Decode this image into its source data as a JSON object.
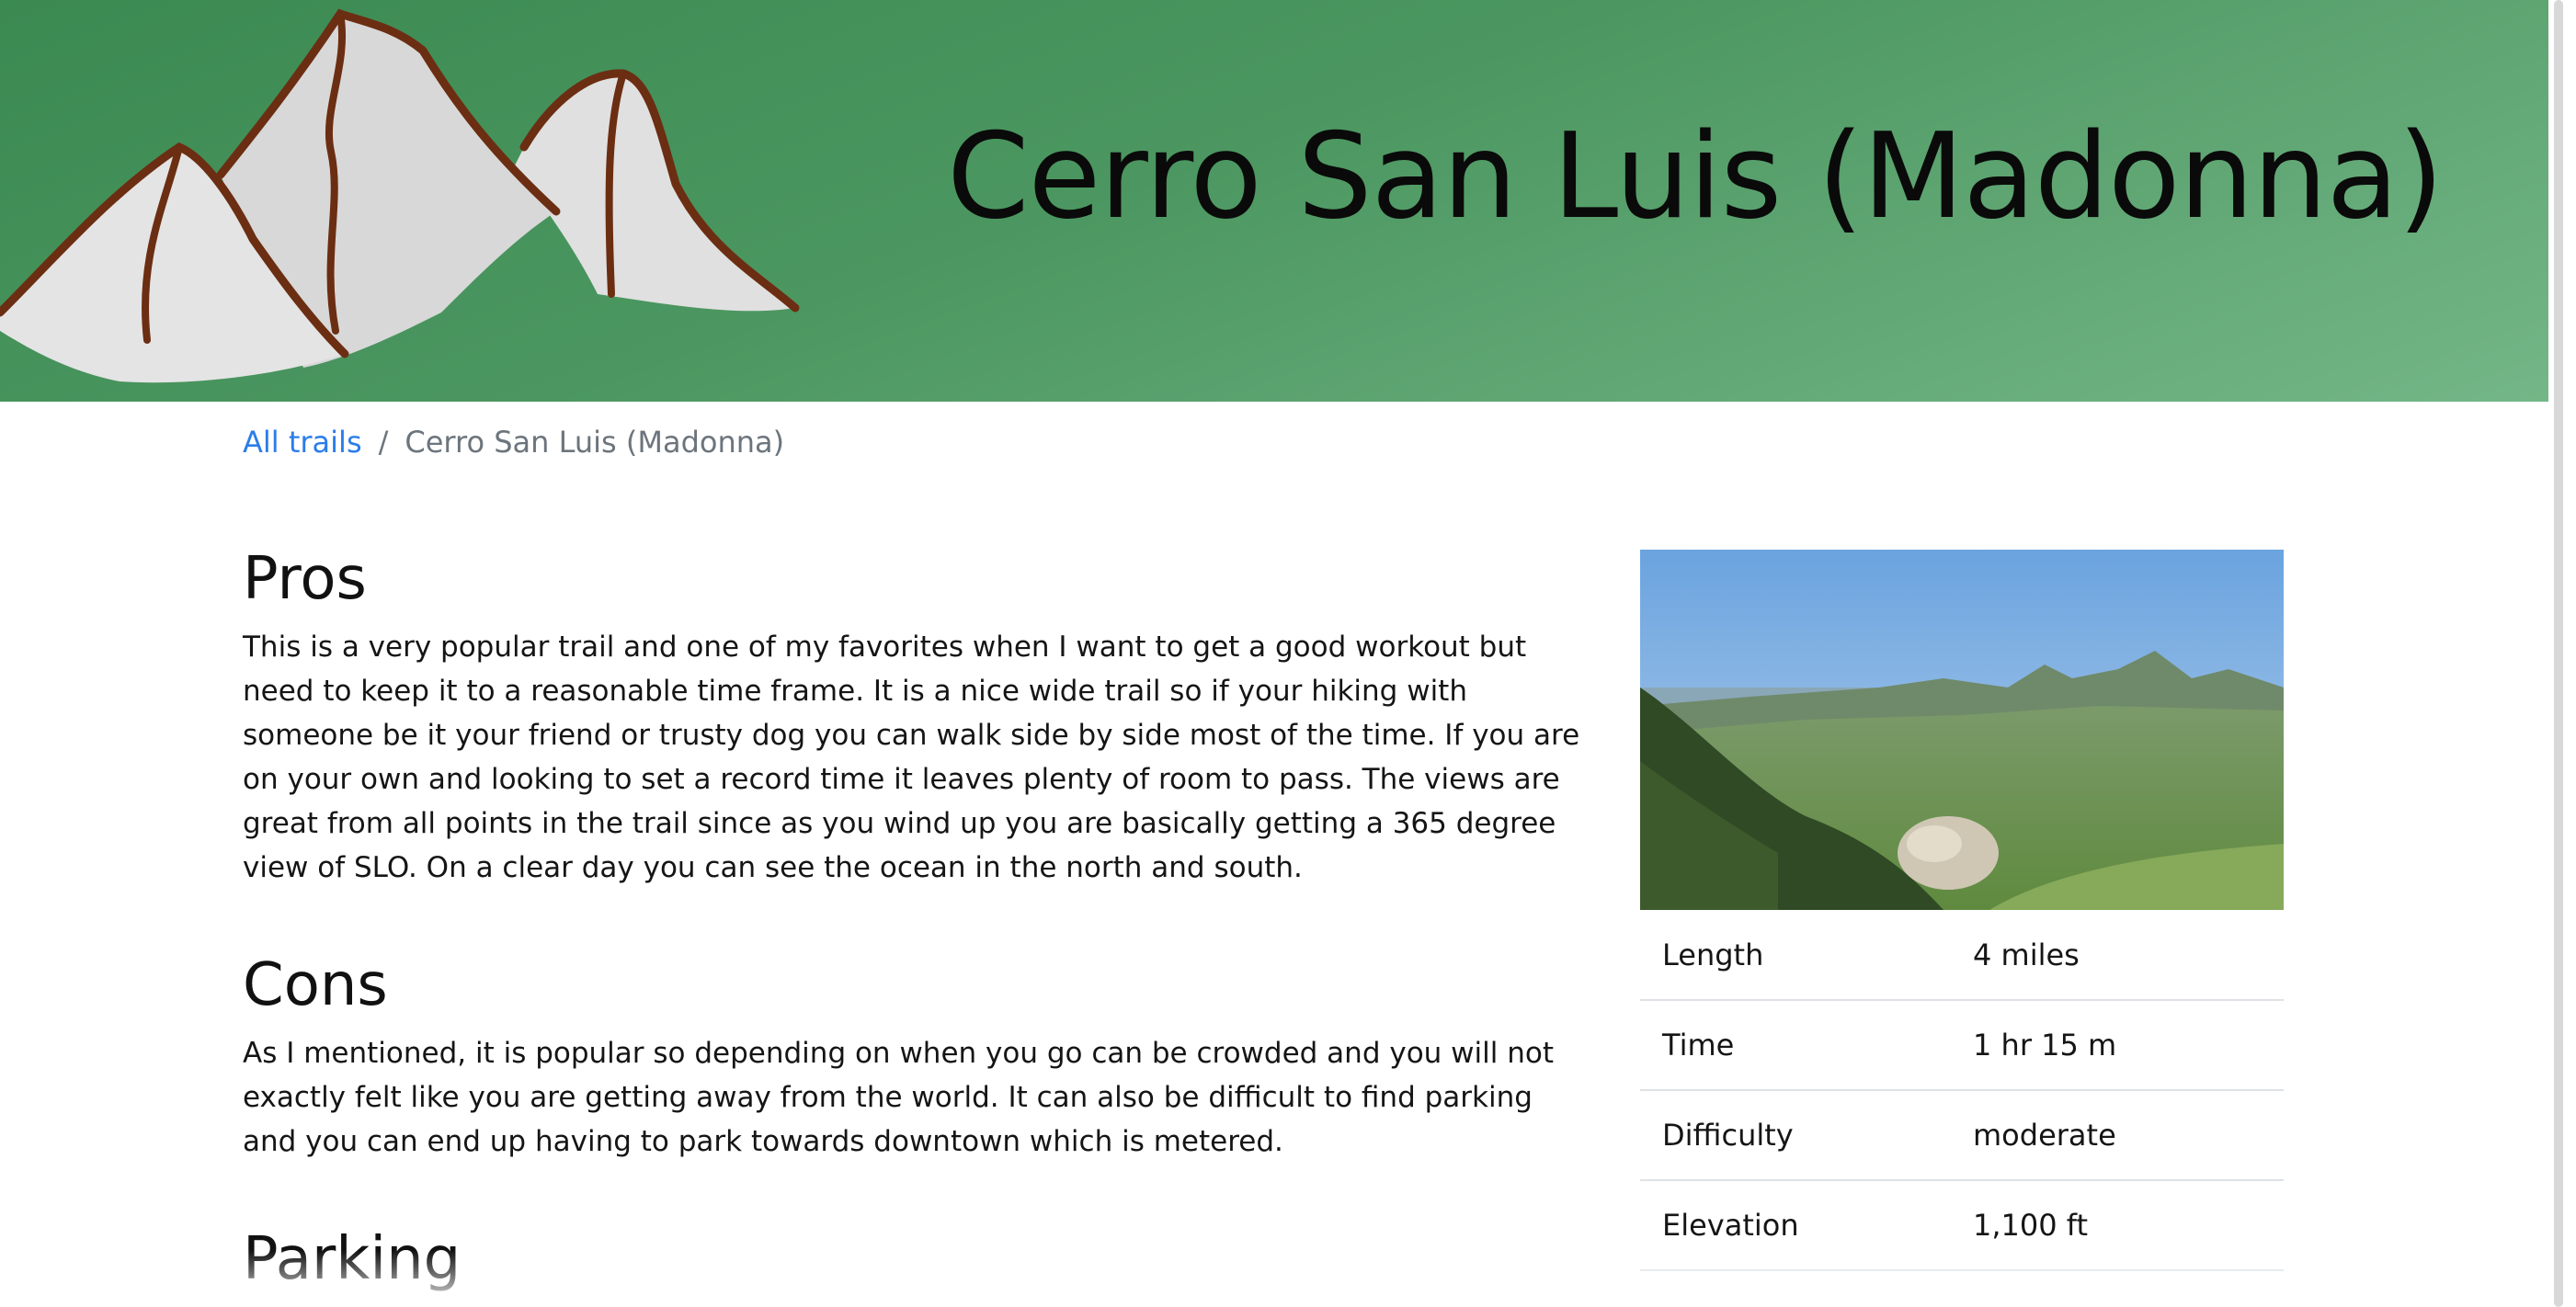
{
  "header": {
    "title": "Cerro San Luis (Madonna)",
    "logo_icon": "mountains-icon",
    "colors": {
      "gradient_start": "#3b8a52",
      "gradient_end": "#74b687",
      "rock": "#e0e0e0",
      "outline": "#6b2e12"
    }
  },
  "breadcrumb": {
    "link_label": "All trails",
    "separator": "/",
    "current": "Cerro San Luis (Madonna)"
  },
  "sections": [
    {
      "title": "Pros",
      "body": "This is a very popular trail and one of my favorites when I want to get a good workout but need to keep it to a reasonable time frame. It is a nice wide trail so if your hiking with someone be it your friend or trusty dog you can walk side by side most of the time. If you are on your own and looking to set a record time it leaves plenty of room to pass. The views are great from all points in the trail since as you wind up you are basically getting a 365 degree view of SLO. On a clear day you can see the ocean in the north and south."
    },
    {
      "title": "Cons",
      "body": "As I mentioned, it is popular so depending on when you go can be crowded and you will not exactly felt like you are getting away from the world. It can also be difficult to find parking and you can end up having to park towards downtown which is metered."
    },
    {
      "title": "Parking",
      "body": ""
    }
  ],
  "trail_info": {
    "photo_icon": "trail-photo",
    "rows": [
      {
        "label": "Length",
        "value": "4 miles"
      },
      {
        "label": "Time",
        "value": "1 hr 15 m"
      },
      {
        "label": "Difficulty",
        "value": "moderate"
      },
      {
        "label": "Elevation",
        "value": "1,100 ft"
      }
    ]
  },
  "link_color": "#2b7de9"
}
